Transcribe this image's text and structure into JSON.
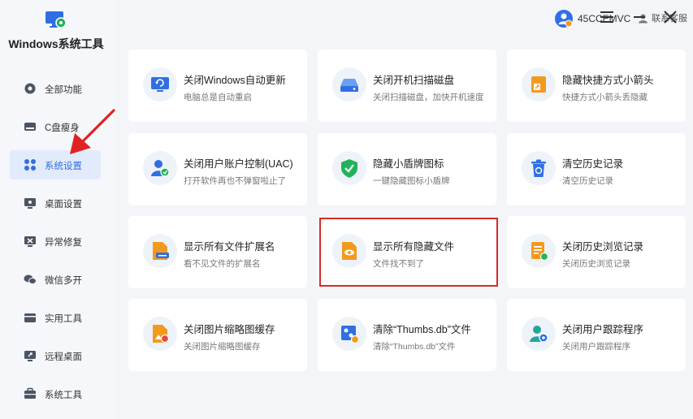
{
  "app": {
    "title": "Windows系统工具"
  },
  "sidebar": {
    "items": [
      {
        "label": "全部功能",
        "icon": "gear-icon"
      },
      {
        "label": "C盘瘦身",
        "icon": "drive-icon"
      },
      {
        "label": "系统设置",
        "icon": "grid-icon",
        "active": true
      },
      {
        "label": "桌面设置",
        "icon": "monitor-icon"
      },
      {
        "label": "异常修复",
        "icon": "repair-icon"
      },
      {
        "label": "微信多开",
        "icon": "wechat-icon"
      },
      {
        "label": "实用工具",
        "icon": "toolbox-icon"
      },
      {
        "label": "远程桌面",
        "icon": "remote-icon"
      },
      {
        "label": "系统工具",
        "icon": "briefcase-icon"
      }
    ]
  },
  "topbar": {
    "user_name": "45CCEMVC",
    "service_label": "联系客服"
  },
  "cards": [
    {
      "title": "关闭Windows自动更新",
      "subtitle": "电脑总是自动重启",
      "icon": "windows-update-icon"
    },
    {
      "title": "关闭开机扫描磁盘",
      "subtitle": "关闭扫描磁盘，加快开机速度",
      "icon": "disk-scan-icon"
    },
    {
      "title": "隐藏快捷方式小箭头",
      "subtitle": "快捷方式小箭头丢隐藏",
      "icon": "shortcut-arrow-icon"
    },
    {
      "title": "关闭用户账户控制(UAC)",
      "subtitle": "打开软件再也不弹窗啦止了",
      "icon": "uac-icon"
    },
    {
      "title": "隐藏小盾牌图标",
      "subtitle": "一键隐藏图标小盾牌",
      "icon": "shield-icon"
    },
    {
      "title": "清空历史记录",
      "subtitle": "清空历史记录",
      "icon": "trash-icon"
    },
    {
      "title": "显示所有文件扩展名",
      "subtitle": "看不见文件的扩展名",
      "icon": "file-extension-icon"
    },
    {
      "title": "显示所有隐藏文件",
      "subtitle": "文件找不到了",
      "icon": "hidden-file-icon"
    },
    {
      "title": "关闭历史浏览记录",
      "subtitle": "关闭历史浏览记录",
      "icon": "browse-history-icon"
    },
    {
      "title": "关闭图片缩略图缓存",
      "subtitle": "关闭图片缩略图缓存",
      "icon": "thumbnail-icon"
    },
    {
      "title": "清除“Thumbs.db”文件",
      "subtitle": "清除“Thumbs.db”文件",
      "icon": "thumbs-db-icon"
    },
    {
      "title": "关闭用户跟踪程序",
      "subtitle": "关闭用户跟踪程序",
      "icon": "user-tracking-icon"
    }
  ],
  "colors": {
    "accent": "#2f6fe3",
    "highlight": "#d62a2a",
    "icon_blue": "#2f6fe3",
    "icon_orange": "#f39a1e",
    "icon_green": "#22b35a"
  }
}
